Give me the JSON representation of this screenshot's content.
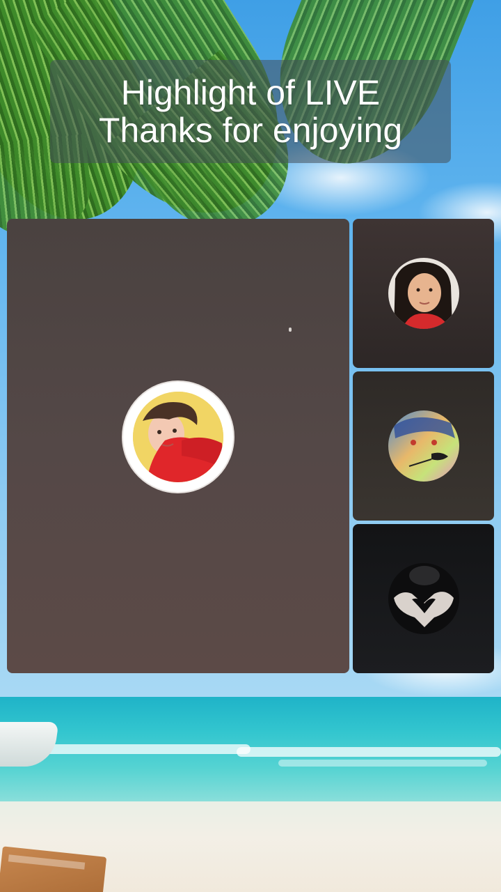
{
  "banner": {
    "line1": "Highlight of LIVE",
    "line2": "Thanks for enjoying"
  },
  "participants": [
    {
      "role": "host",
      "avatar": "host-avatar"
    },
    {
      "role": "guest",
      "avatar": "guest-1-avatar"
    },
    {
      "role": "guest",
      "avatar": "guest-2-avatar"
    },
    {
      "role": "guest",
      "avatar": "guest-3-avatar"
    }
  ],
  "colors": {
    "banner_bg": "#46505a",
    "tile_main": "#544847",
    "tile_dark": "#1c1d20",
    "sky": "#5ab4ea",
    "sea": "#33c6cf"
  }
}
